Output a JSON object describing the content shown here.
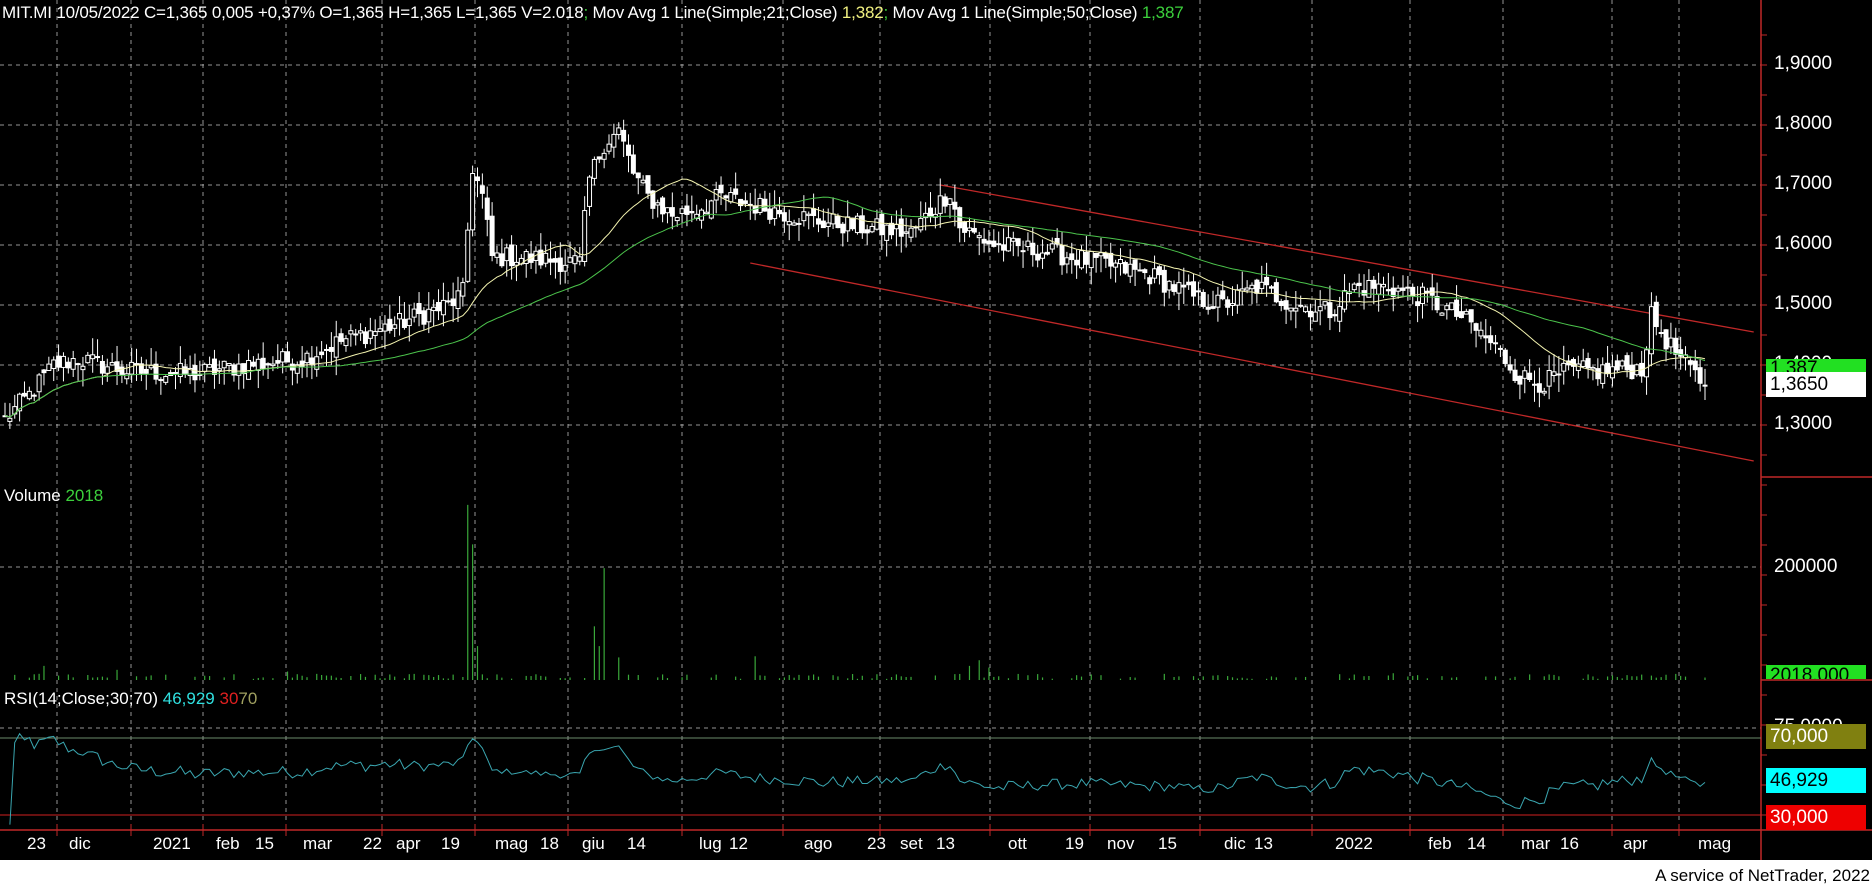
{
  "header": {
    "symbol": "MIT.MI",
    "date": "10/05/2022",
    "quote": "C=1,365 0,005 +0,37% O=1,365 H=1,365 L=1,365 V=2.018",
    "sep": ";",
    "ma21_label": "Mov Avg 1 Line(Simple;21;Close)",
    "ma21_value": "1,382",
    "ma50_label": "Mov Avg 1 Line(Simple;50;Close)",
    "ma50_value": "1,387"
  },
  "volume_pane": {
    "label": "Volume",
    "value": "2018",
    "axis_label": "200000",
    "current_box": "2018,000"
  },
  "rsi_pane": {
    "label": "RSI(14;Close;30;70)",
    "value": "46,929",
    "low": "30",
    "high": "70",
    "axis_label": "75,0000",
    "box_70": "70,000",
    "box_value": "46,929",
    "box_30": "30,000"
  },
  "price_axis": {
    "labels": [
      "1,9000",
      "1,8000",
      "1,7000",
      "1,6000",
      "1,5000",
      "1,4000",
      "1,3000"
    ],
    "ma50_box": "1,387",
    "last_box": "1,3650"
  },
  "x_axis": {
    "labels": [
      "23",
      "dic",
      "2021",
      "feb",
      "15",
      "mar",
      "22",
      "apr",
      "19",
      "mag",
      "18",
      "giu",
      "14",
      "lug",
      "12",
      "ago",
      "23",
      "set",
      "13",
      "ott",
      "19",
      "nov",
      "15",
      "dic",
      "13",
      "2022",
      "feb",
      "14",
      "mar",
      "16",
      "apr",
      "mag"
    ]
  },
  "footer": "A service of NetTrader, 2022",
  "colors": {
    "bg": "#000000",
    "candle": "#ffffff",
    "ma21": "#f4f4b0",
    "ma50": "#4cc44c",
    "channel": "#c02828",
    "rsi": "#3aa6b0",
    "grid": "#bbbbbb",
    "axis": "#c02828",
    "volume": "#3aa83a",
    "header_ma21": "#f0f080",
    "header_ma50": "#3cd03c",
    "rsi_value": "#30e0e0",
    "rsi_low": "#e02020",
    "rsi_high": "#a0a060"
  },
  "chart_data": {
    "type": "candlestick",
    "title": "MIT.MI daily",
    "n_days": 350,
    "close_keypoints": [
      [
        0,
        1.31
      ],
      [
        5,
        1.35
      ],
      [
        10,
        1.4
      ],
      [
        15,
        1.41
      ],
      [
        25,
        1.39
      ],
      [
        39,
        1.385
      ],
      [
        49,
        1.4
      ],
      [
        61,
        1.41
      ],
      [
        69,
        1.44
      ],
      [
        81,
        1.47
      ],
      [
        91,
        1.5
      ],
      [
        94,
        1.52
      ],
      [
        96,
        1.73
      ],
      [
        98,
        1.68
      ],
      [
        100,
        1.58
      ],
      [
        105,
        1.58
      ],
      [
        118,
        1.57
      ],
      [
        120,
        1.71
      ],
      [
        123,
        1.77
      ],
      [
        126,
        1.79
      ],
      [
        129,
        1.72
      ],
      [
        132,
        1.68
      ],
      [
        137,
        1.65
      ],
      [
        142,
        1.66
      ],
      [
        147,
        1.68
      ],
      [
        157,
        1.66
      ],
      [
        167,
        1.64
      ],
      [
        176,
        1.63
      ],
      [
        186,
        1.62
      ],
      [
        194,
        1.69
      ],
      [
        196,
        1.63
      ],
      [
        203,
        1.6
      ],
      [
        213,
        1.59
      ],
      [
        225,
        1.57
      ],
      [
        235,
        1.55
      ],
      [
        245,
        1.51
      ],
      [
        250,
        1.5
      ],
      [
        257,
        1.53
      ],
      [
        265,
        1.5
      ],
      [
        272,
        1.49
      ],
      [
        277,
        1.53
      ],
      [
        284,
        1.53
      ],
      [
        292,
        1.51
      ],
      [
        299,
        1.48
      ],
      [
        306,
        1.43
      ],
      [
        311,
        1.38
      ],
      [
        316,
        1.37
      ],
      [
        321,
        1.39
      ],
      [
        328,
        1.39
      ],
      [
        336,
        1.395
      ],
      [
        338,
        1.48
      ],
      [
        342,
        1.43
      ],
      [
        345,
        1.4
      ],
      [
        349,
        1.365
      ]
    ],
    "volume_spikes": [
      [
        8,
        25000
      ],
      [
        23,
        18000
      ],
      [
        58,
        15000
      ],
      [
        95,
        310000
      ],
      [
        96,
        240000
      ],
      [
        97,
        60000
      ],
      [
        121,
        95000
      ],
      [
        122,
        60000
      ],
      [
        123,
        198000
      ],
      [
        126,
        40000
      ],
      [
        154,
        42000
      ],
      [
        198,
        25000
      ],
      [
        200,
        35000
      ],
      [
        202,
        22000
      ],
      [
        285,
        12000
      ]
    ],
    "price_ylim": [
      1.22,
      1.92
    ],
    "volume_ylim": [
      0,
      340000
    ],
    "rsi_ylim": [
      18,
      82
    ],
    "rsi_levels": [
      30,
      70
    ],
    "moving_averages": [
      21,
      50
    ],
    "channel": {
      "upper": [
        [
          192,
          1.7
        ],
        [
          359,
          1.455
        ]
      ],
      "lower": [
        [
          153,
          1.57
        ],
        [
          359,
          1.24
        ]
      ]
    }
  }
}
